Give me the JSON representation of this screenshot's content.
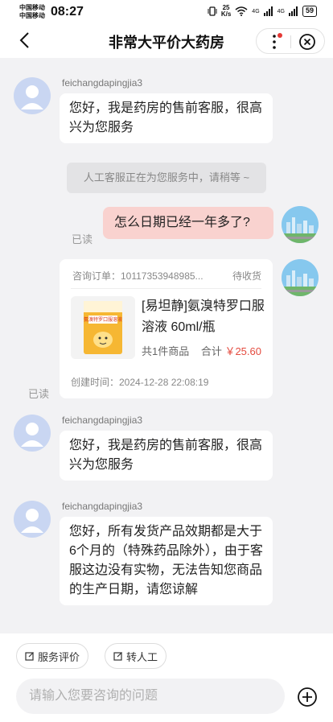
{
  "status_bar": {
    "carrier1": "中国移动",
    "carrier2": "中国移动",
    "time": "08:27",
    "net_speed_top": "25",
    "net_speed_bottom": "K/s",
    "signal1": "4G",
    "signal2": "4G",
    "battery": "59"
  },
  "nav": {
    "title": "非常大平价大药房",
    "back_icon": "back-arrow-icon",
    "more_icon": "more-vertical-icon",
    "close_icon": "close-circle-icon"
  },
  "messages": {
    "m1_sender": "feichangdapingjia3",
    "m1_text": "您好，我是药房的售前客服，很高兴为您服务",
    "system": "人工客服正在为您服务中，请稍等 ~",
    "m2_text": "怎么日期已经一年多了?",
    "m2_read": "已读",
    "m3_sender": "feichangdapingjia3",
    "m3_text": "您好，我是药房的售前客服，很高兴为您服务",
    "m4_sender": "feichangdapingjia3",
    "m4_text": "您好，所有发货产品效期都是大于6个月的（特殊药品除外），由于客服这边没有实物，无法告知您商品的生产日期，请您谅解"
  },
  "order": {
    "number": "咨询订单：10117353948985...",
    "status": "待收货",
    "product_name": "[易坦静]氨溴特罗口服溶液 60ml/瓶",
    "quantity": "共1件商品",
    "total_label": "合计",
    "total_price": "￥25.60",
    "created": "创建时间：2024-12-28 22:08:19",
    "read": "已读",
    "box_text": "氨溴特罗口服溶液"
  },
  "bottom": {
    "rate_button": "服务评价",
    "transfer_button": "转人工",
    "input_placeholder": "请输入您要咨询的问题"
  },
  "colors": {
    "outgoing_bubble": "#f9d2cf",
    "price": "#e44b3f",
    "avatar": "#c9d6f2"
  }
}
